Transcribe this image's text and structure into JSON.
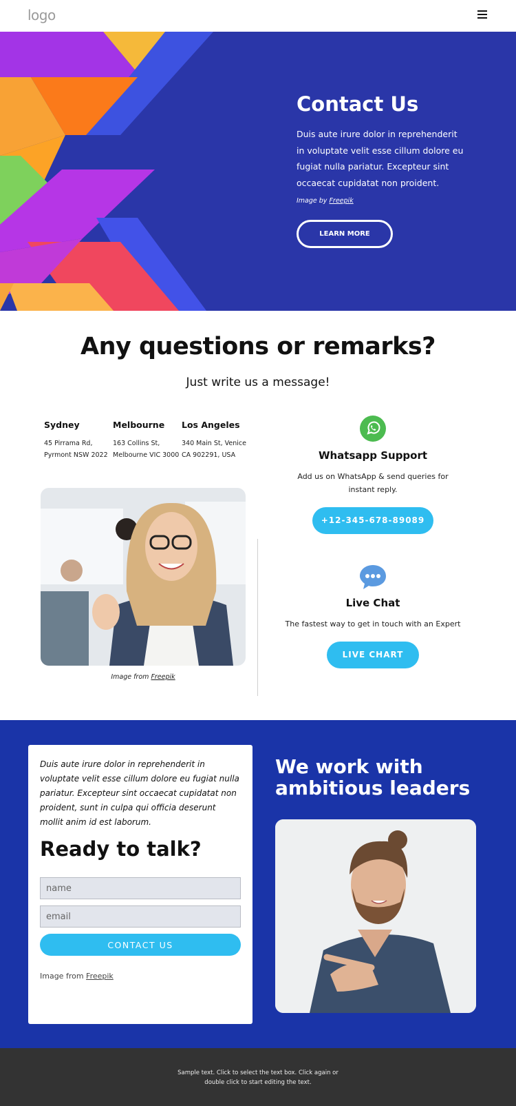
{
  "header": {
    "logo": "logo",
    "menu_icon": "hamburger-menu-icon"
  },
  "hero": {
    "title": "Contact Us",
    "text": "Duis aute irure dolor in reprehenderit in voluptate velit esse cillum dolore eu fugiat nulla pariatur. Excepteur sint occaecat cupidatat non proident.",
    "credit_prefix": "Image by",
    "credit_link": "Freepik",
    "button_label": "LEARN MORE"
  },
  "questions": {
    "title": "Any questions or remarks?",
    "subtitle": "Just write us a message!"
  },
  "offices": [
    {
      "city": "Sydney",
      "address": "45 Pirrama Rd, Pyrmont NSW 2022"
    },
    {
      "city": "Melbourne",
      "address": "163 Collins St, Melbourne VIC 3000"
    },
    {
      "city": "Los Angeles",
      "address": "340 Main St, Venice CA 902291, USA"
    }
  ],
  "photo_credit": {
    "prefix": "Image from",
    "link": "Freepik"
  },
  "whatsapp": {
    "icon": "whatsapp-icon",
    "title": "Whatsapp Support",
    "text": "Add us on WhatsApp & send queries for instant reply.",
    "button_label": "+12-345-678-89089"
  },
  "livechat": {
    "icon": "chat-bubble-icon",
    "title": "Live Chat",
    "text": "The fastest way to get in touch with an Expert",
    "button_label": "LIVE CHART"
  },
  "contact_card": {
    "quote": "Duis aute irure dolor in reprehenderit in voluptate velit esse cillum dolore eu fugiat nulla pariatur. Excepteur sint occaecat cupidatat non proident, sunt in culpa qui officia deserunt mollit anim id est laborum.",
    "title": "Ready to talk?",
    "name_placeholder": "name",
    "email_placeholder": "email",
    "button_label": "CONTACT US",
    "credit_prefix": "Image from",
    "credit_link": "Freepik"
  },
  "band": {
    "title": "We work with ambitious leaders"
  },
  "footer": {
    "text": "Sample text. Click to select the text box. Click again or double click to start editing the text."
  },
  "colors": {
    "hero_bg": "#2a36a8",
    "band_bg": "#1a34a8",
    "accent": "#2fbdf0",
    "footer_bg": "#333333"
  }
}
